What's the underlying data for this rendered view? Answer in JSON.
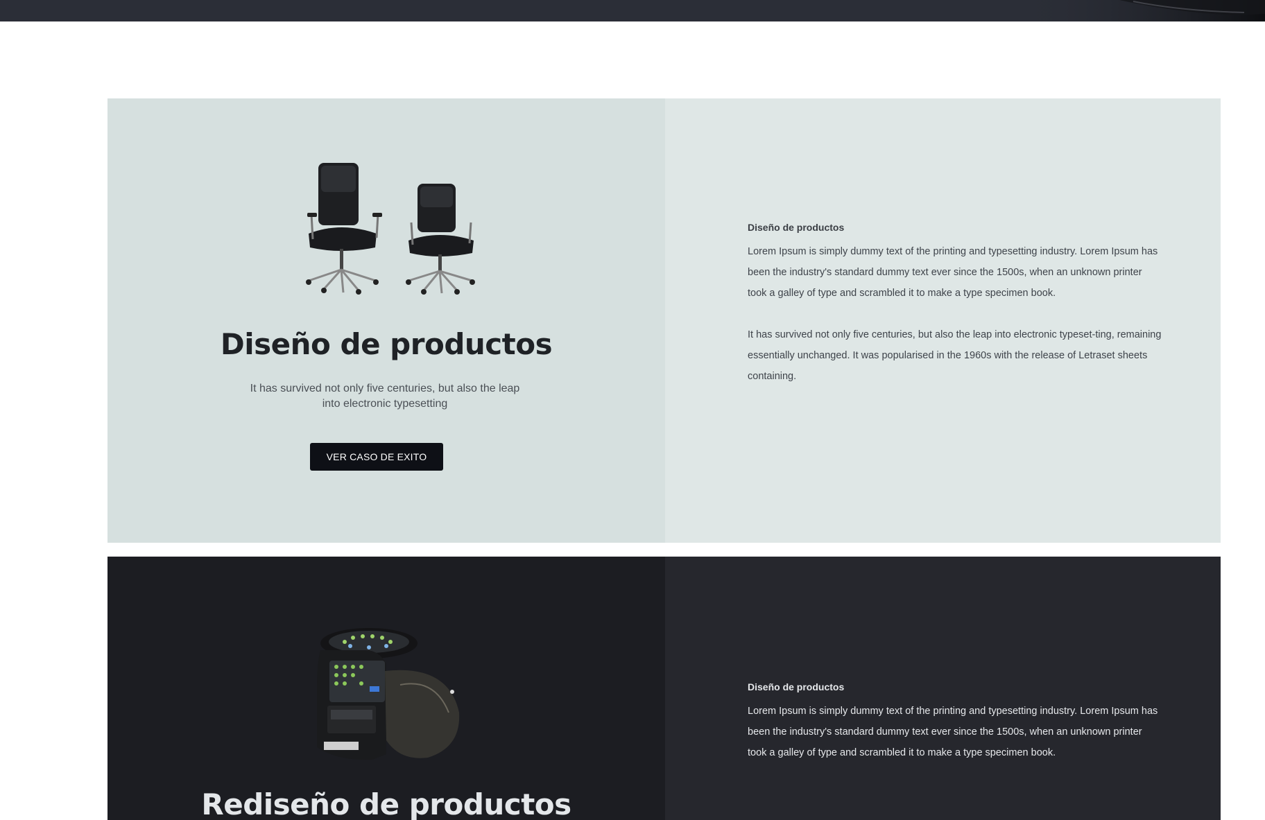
{
  "cards": [
    {
      "image_icon": "office-chairs-image",
      "title": "Diseño de productos",
      "subtitle": "It has survived not only five centuries, but also the leap into electronic typesetting",
      "button_label": "VER CASO DE EXITO",
      "detail_heading": "Diseño de productos",
      "detail_paragraphs": [
        "Lorem Ipsum is simply dummy text of the printing and typesetting industry. Lorem Ipsum has been the industry's standard dummy text ever since the 1500s, when an unknown printer took a galley of type and scrambled it to make a type specimen book.",
        "It has survived not only five centuries, but also the leap into electronic typeset-ting, remaining essentially unchanged. It was popularised in the 1960s with the release of Letraset sheets containing."
      ],
      "colors": {
        "left_bg": "#d6e0df",
        "right_bg": "#dfe7e6",
        "button_bg": "#0e1016"
      }
    },
    {
      "image_icon": "dispenser-device-image",
      "title": "Rediseño de productos",
      "detail_heading": "Diseño de productos",
      "detail_paragraphs": [
        "Lorem Ipsum is simply dummy text of the printing and typesetting industry. Lorem Ipsum has been the industry's standard dummy text ever since the 1500s, when an unknown printer took a galley of type and scrambled it to make a type specimen book."
      ],
      "colors": {
        "left_bg": "#1c1d22",
        "right_bg": "#26272d"
      }
    }
  ],
  "header": {
    "bar_color": "#2b2e37"
  }
}
